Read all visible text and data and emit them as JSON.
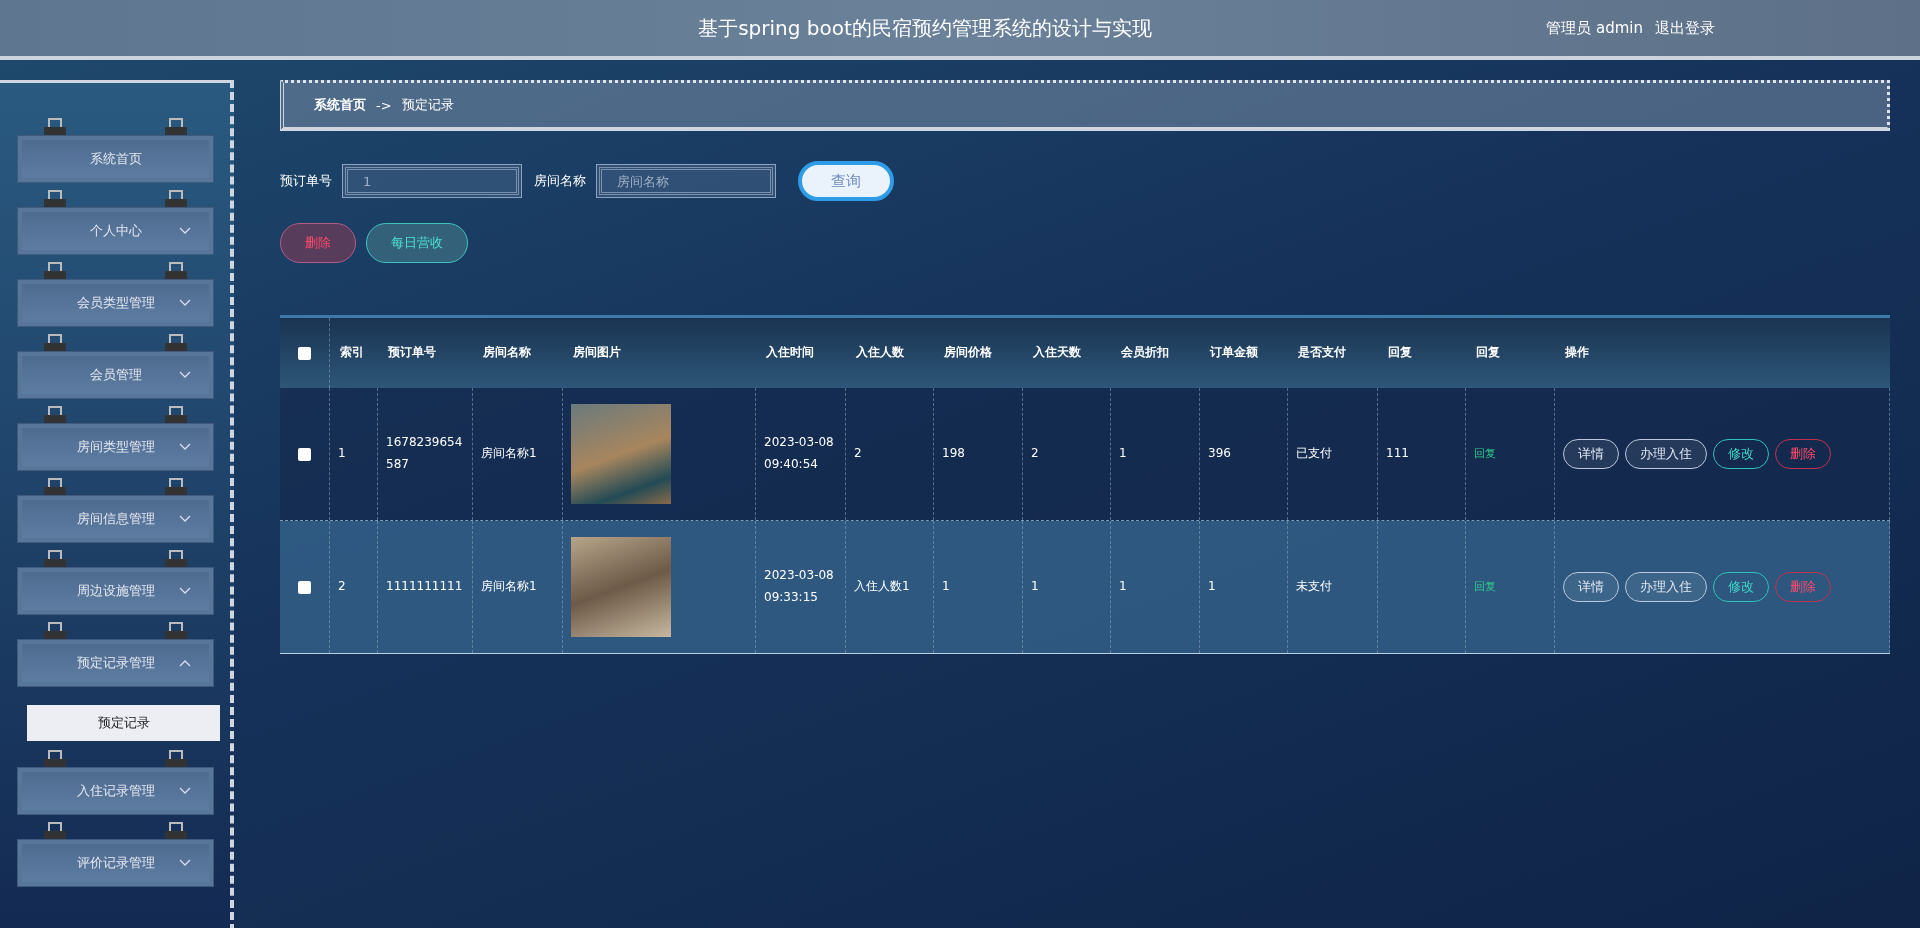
{
  "header": {
    "title": "基于spring boot的民宿预约管理系统的设计与实现",
    "user": "管理员 admin",
    "logout": "退出登录"
  },
  "sidebar": {
    "items": [
      {
        "label": "系统首页",
        "expandable": false
      },
      {
        "label": "个人中心",
        "expandable": true,
        "expanded": false
      },
      {
        "label": "会员类型管理",
        "expandable": true,
        "expanded": false
      },
      {
        "label": "会员管理",
        "expandable": true,
        "expanded": false
      },
      {
        "label": "房间类型管理",
        "expandable": true,
        "expanded": false
      },
      {
        "label": "房间信息管理",
        "expandable": true,
        "expanded": false
      },
      {
        "label": "周边设施管理",
        "expandable": true,
        "expanded": false
      },
      {
        "label": "预定记录管理",
        "expandable": true,
        "expanded": true,
        "children": [
          {
            "label": "预定记录",
            "selected": true
          }
        ]
      },
      {
        "label": "入住记录管理",
        "expandable": true,
        "expanded": false
      },
      {
        "label": "评价记录管理",
        "expandable": true,
        "expanded": false
      }
    ]
  },
  "breadcrumb": [
    {
      "label": "系统首页",
      "kind": "link"
    },
    {
      "label": "->",
      "kind": "separator"
    },
    {
      "label": "预定记录",
      "kind": "current"
    }
  ],
  "search": {
    "fields": [
      {
        "label": "预订单号",
        "placeholder": "1"
      },
      {
        "label": "房间名称",
        "placeholder": "房间名称"
      }
    ],
    "button": "查询"
  },
  "actions": [
    {
      "label": "删除",
      "kind": "danger"
    },
    {
      "label": "每日营收",
      "kind": "teal"
    }
  ],
  "table": {
    "select_all": {
      "checked": false
    },
    "columns": [
      "索引",
      "预订单号",
      "房间名称",
      "房间图片",
      "入住时间",
      "入住人数",
      "房间价格",
      "入住天数",
      "会员折扣",
      "订单金额",
      "是否支付",
      "回复",
      "回复",
      "操作"
    ],
    "rows": [
      {
        "checked": false,
        "index": "1",
        "order_no": "1678239654587",
        "room_name": "房间名称1",
        "checkin_time": "2023-03-08 09:40:54",
        "guests": "2",
        "price": "198",
        "days": "2",
        "discount": "1",
        "amount": "396",
        "paid": "已支付",
        "reply": "111",
        "reply_link": "回复",
        "actions": [
          {
            "label": "详情",
            "kind": "plain"
          },
          {
            "label": "办理入住",
            "kind": "plain"
          },
          {
            "label": "修改",
            "kind": "teal"
          },
          {
            "label": "删除",
            "kind": "danger"
          }
        ]
      },
      {
        "checked": false,
        "index": "2",
        "order_no": "1111111111",
        "room_name": "房间名称1",
        "checkin_time": "2023-03-08 09:33:15",
        "guests": "入住人数1",
        "price": "1",
        "days": "1",
        "discount": "1",
        "amount": "1",
        "paid": "未支付",
        "reply_link": "回复",
        "actions": [
          {
            "label": "详情",
            "kind": "plain"
          },
          {
            "label": "办理入住",
            "kind": "plain"
          },
          {
            "label": "修改",
            "kind": "teal"
          },
          {
            "label": "删除",
            "kind": "danger"
          }
        ]
      }
    ]
  }
}
